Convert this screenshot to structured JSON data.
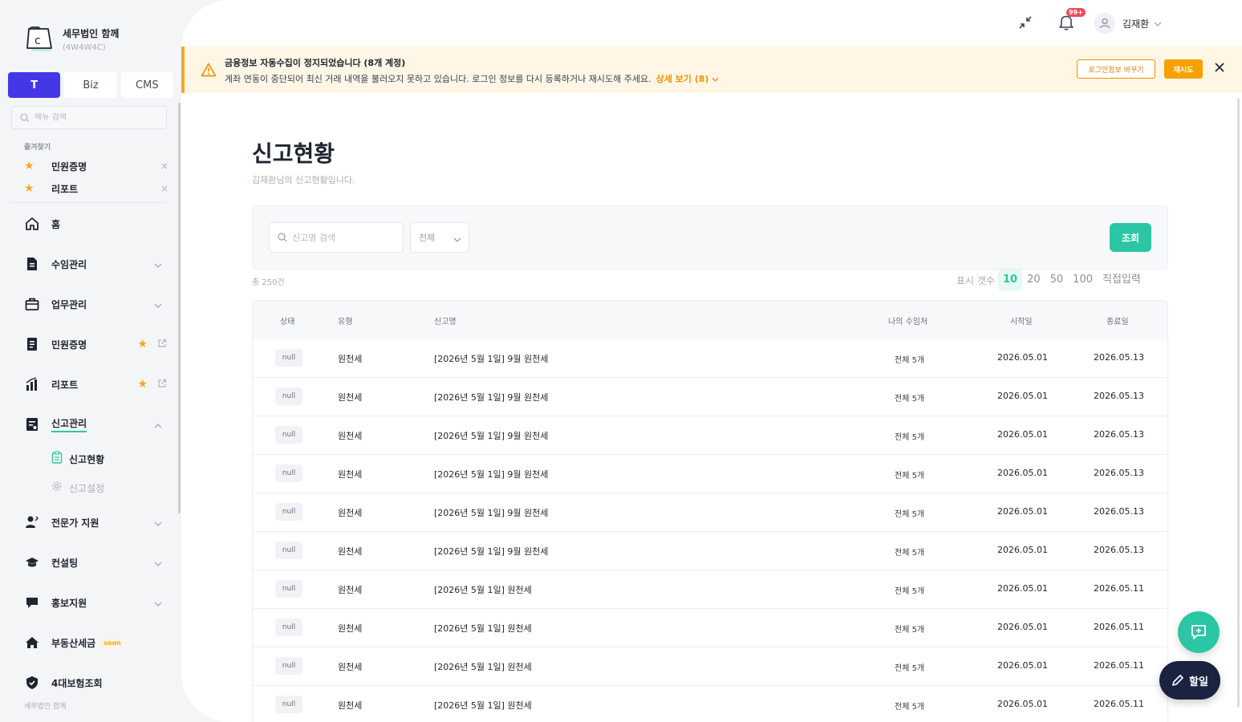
{
  "brand": {
    "name": "세무법인 함께",
    "code": "(4W4W4C)"
  },
  "segments": [
    {
      "label": "T"
    },
    {
      "label": "Biz"
    },
    {
      "label": "CMS"
    }
  ],
  "menu_search": {
    "placeholder": "메뉴 검색"
  },
  "favorites": {
    "title": "즐겨찾기",
    "items": [
      {
        "label": "민원증명"
      },
      {
        "label": "리포트"
      }
    ]
  },
  "nav": {
    "home": "홈",
    "income": "수임관리",
    "task": "업무관리",
    "civil": "민원증명",
    "report": "리포트",
    "filing": "신고관리",
    "filing_status": "신고현황",
    "filing_settings": "신고설정",
    "expert": "전문가 지원",
    "consulting": "컨설팅",
    "promo": "홍보지원",
    "realestate": "부동산세금",
    "realestate_badge": "soon",
    "insurance": "4대보험조회"
  },
  "sidebar_footer": "세무법인 함께",
  "topbar": {
    "notification_badge": "99+",
    "user_name": "김재환"
  },
  "alert": {
    "title": "금융정보 자동수집이 정지되었습니다 (8개 계정)",
    "description": "계좌 연동이 중단되어 최신 거래 내역을 불러오지 못하고 있습니다. 로그인 정보를 다시 등록하거나 재시도해 주세요.",
    "link": "상세 보기 (8)",
    "change_login_button": "로그인정보 바꾸기",
    "retry_button": "재시도"
  },
  "page": {
    "title": "신고현황",
    "subtitle": "김재환님의 신고현황입니다."
  },
  "filter": {
    "search_placeholder": "신고명 검색",
    "select_value": "전체",
    "query_button": "조회"
  },
  "total": "총 250건",
  "per_page": {
    "label": "표시 갯수",
    "options": [
      "10",
      "20",
      "50",
      "100",
      "직접입력"
    ],
    "selected": "10"
  },
  "table": {
    "columns": [
      "상태",
      "유형",
      "신고명",
      "나의 수임처",
      "시작일",
      "종료일"
    ],
    "rows": [
      {
        "status": "null",
        "type": "원천세",
        "name": "[2026년 5월 1일] 9월 원천세",
        "count": "전체 5개",
        "start": "2026.05.01",
        "end": "2026.05.13"
      },
      {
        "status": "null",
        "type": "원천세",
        "name": "[2026년 5월 1일] 9월 원천세",
        "count": "전체 5개",
        "start": "2026.05.01",
        "end": "2026.05.13"
      },
      {
        "status": "null",
        "type": "원천세",
        "name": "[2026년 5월 1일] 9월 원천세",
        "count": "전체 5개",
        "start": "2026.05.01",
        "end": "2026.05.13"
      },
      {
        "status": "null",
        "type": "원천세",
        "name": "[2026년 5월 1일] 9월 원천세",
        "count": "전체 5개",
        "start": "2026.05.01",
        "end": "2026.05.13"
      },
      {
        "status": "null",
        "type": "원천세",
        "name": "[2026년 5월 1일] 9월 원천세",
        "count": "전체 5개",
        "start": "2026.05.01",
        "end": "2026.05.13"
      },
      {
        "status": "null",
        "type": "원천세",
        "name": "[2026년 5월 1일] 9월 원천세",
        "count": "전체 5개",
        "start": "2026.05.01",
        "end": "2026.05.13"
      },
      {
        "status": "null",
        "type": "원천세",
        "name": "[2026년 5월 1일] 원천세",
        "count": "전체 5개",
        "start": "2026.05.01",
        "end": "2026.05.11"
      },
      {
        "status": "null",
        "type": "원천세",
        "name": "[2026년 5월 1일] 원천세",
        "count": "전체 5개",
        "start": "2026.05.01",
        "end": "2026.05.11"
      },
      {
        "status": "null",
        "type": "원천세",
        "name": "[2026년 5월 1일] 원천세",
        "count": "전체 5개",
        "start": "2026.05.01",
        "end": "2026.05.11"
      },
      {
        "status": "null",
        "type": "원천세",
        "name": "[2026년 5월 1일] 원천세",
        "count": "전체 5개",
        "start": "2026.05.01",
        "end": "2026.05.11"
      }
    ]
  },
  "fab": {
    "todo_label": "할일"
  },
  "colors": {
    "primary": "#4437e6",
    "accent": "#2bc6a4",
    "warning": "#f5a623",
    "navy": "#1a2340"
  }
}
